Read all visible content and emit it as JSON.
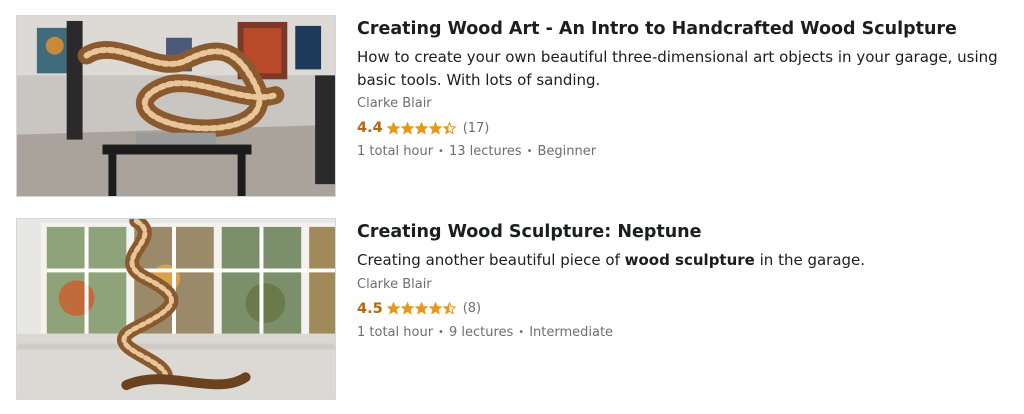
{
  "courses": [
    {
      "title": "Creating Wood Art - An Intro to Handcrafted Wood Sculpture",
      "description": "How to create your own beautiful three-dimensional art objects in your garage, using basic tools. With lots of sanding.",
      "instructor": "Clarke Blair",
      "rating": "4.4",
      "stars_filled_fraction": 0.88,
      "rating_count": "(17)",
      "duration": "1 total hour",
      "lectures": "13 lectures",
      "level": "Beginner",
      "thumbnail_icon": "wood-sculpture-gallery-photo"
    },
    {
      "title": "Creating Wood Sculpture: Neptune",
      "description_before": "Creating another beautiful piece of ",
      "description_bold": "wood sculpture",
      "description_after": " in the garage.",
      "instructor": "Clarke Blair",
      "rating": "4.5",
      "stars_filled_fraction": 0.9,
      "rating_count": "(8)",
      "duration": "1 total hour",
      "lectures": "9 lectures",
      "level": "Intermediate",
      "thumbnail_icon": "wood-sculpture-window-photo"
    }
  ],
  "colors": {
    "rating_accent": "#b4690e",
    "star_fill": "#e59819",
    "muted_text": "#6a6f73"
  }
}
